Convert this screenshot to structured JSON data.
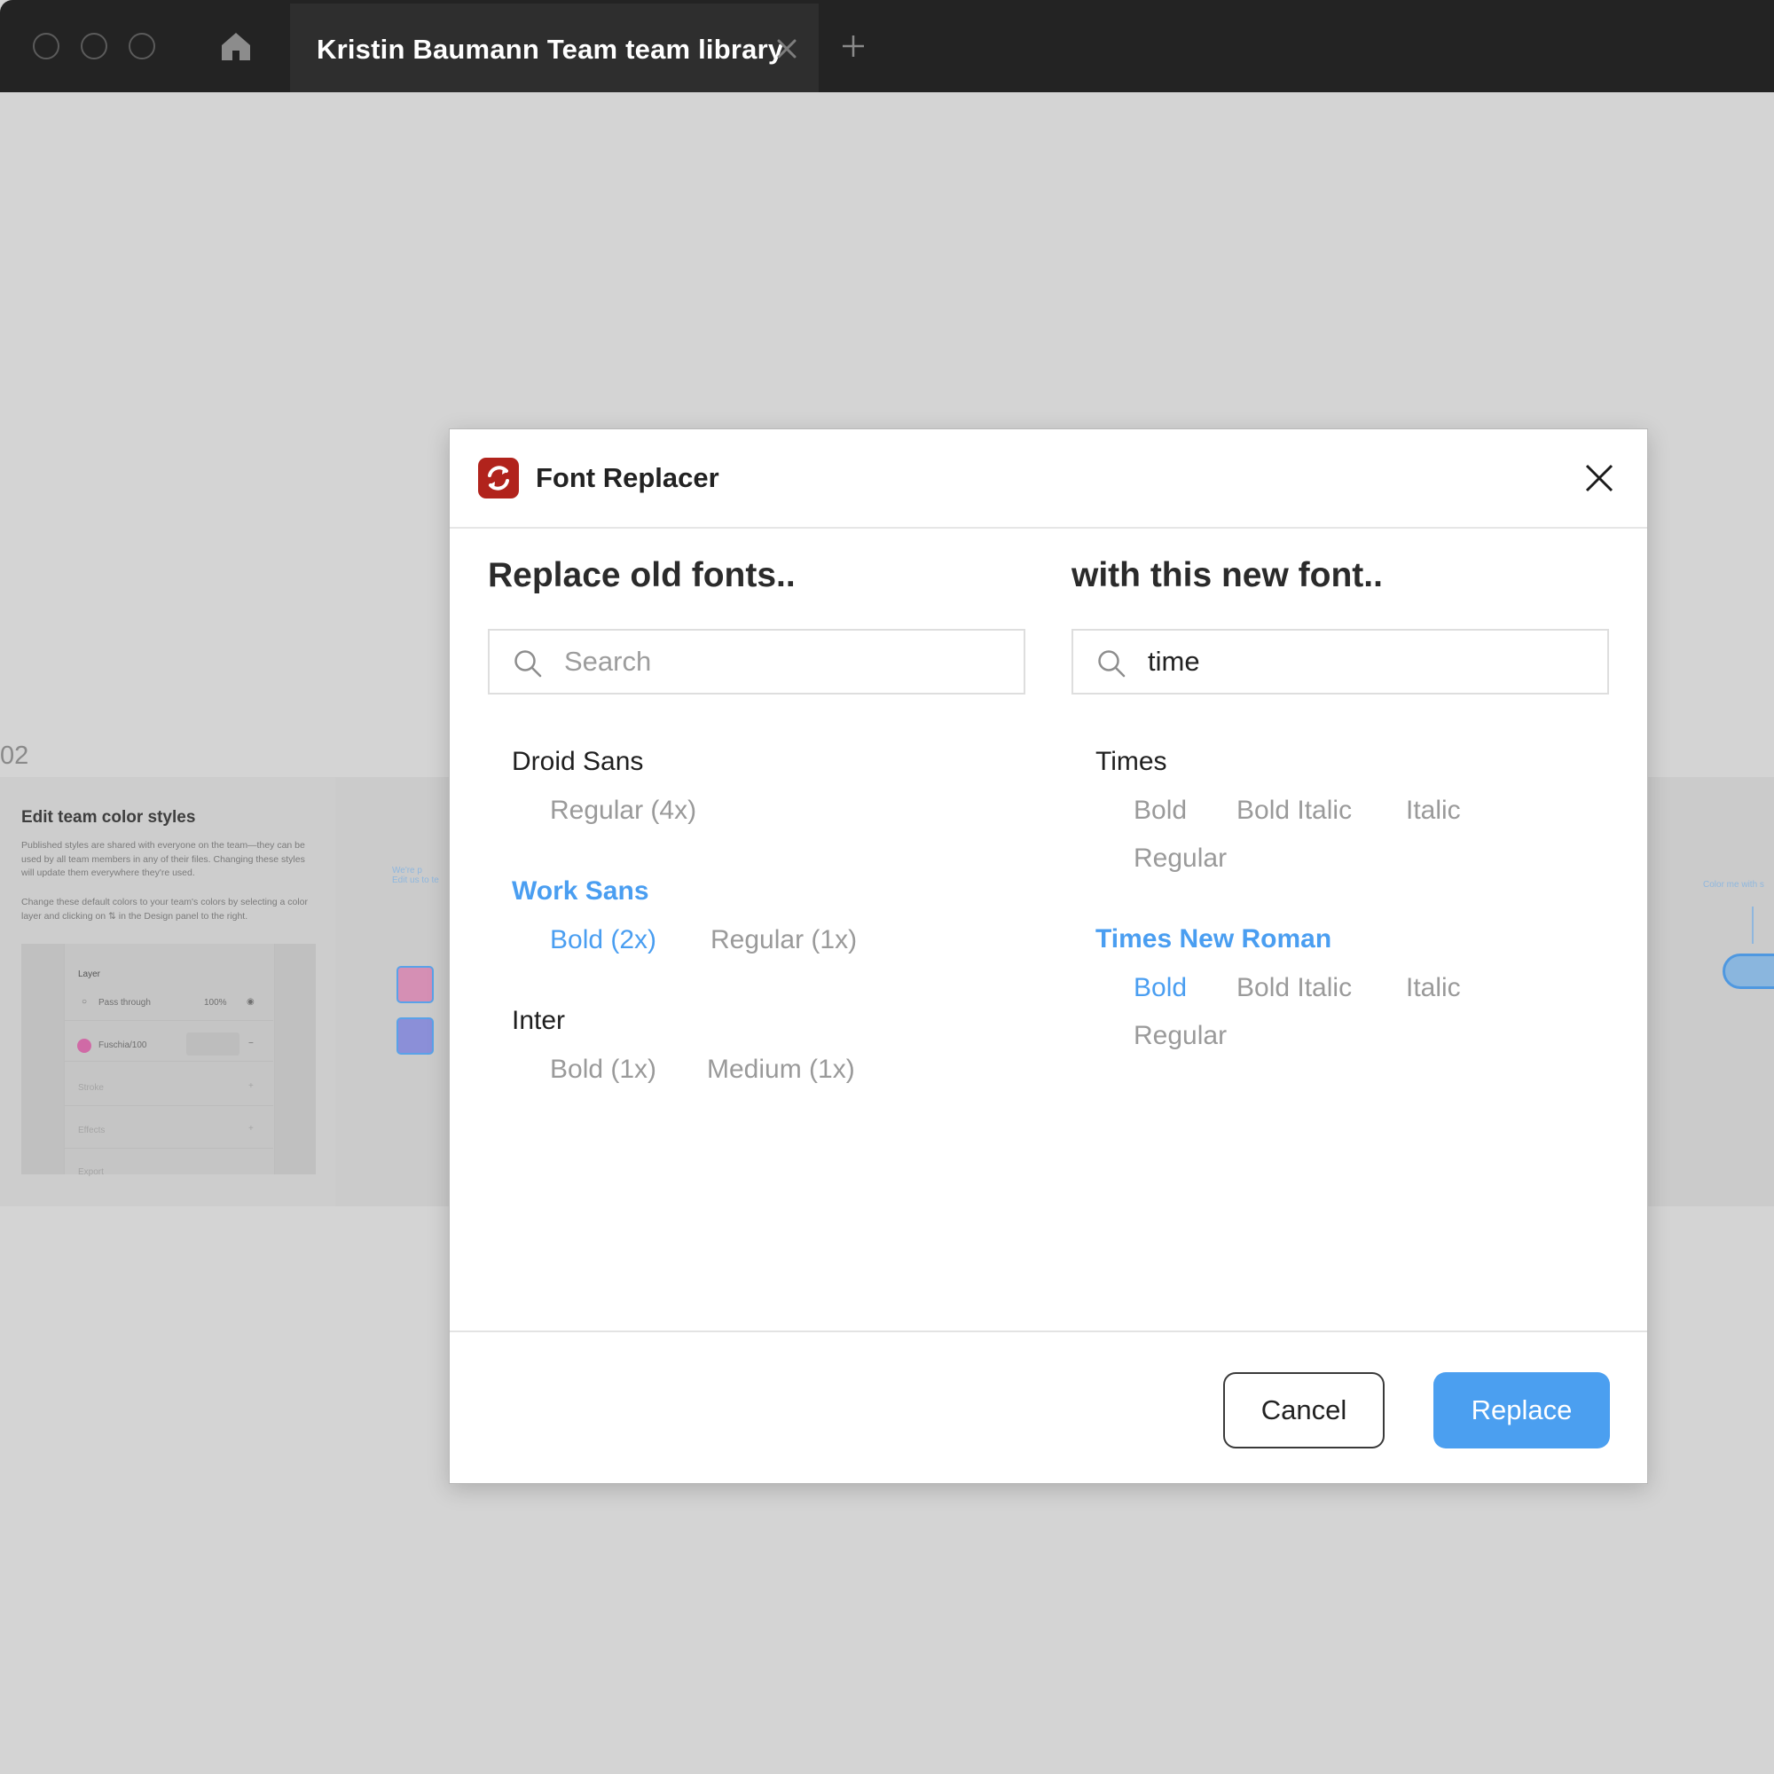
{
  "window": {
    "tab_title": "Kristin Baumann Team team library"
  },
  "canvas": {
    "frame_number": "02",
    "card_title": "Edit team color styles",
    "card_desc": "Published styles are shared with everyone on the team—they can be used by all team members in any of their files. Changing these styles will update them everywhere they're used.",
    "card_desc2": "Change these default colors to your team's colors by selecting a color layer and clicking on ⇅ in the Design panel to the right.",
    "panel": {
      "layer_label": "Layer",
      "blend_mode": "Pass through",
      "opacity": "100%",
      "fill_name": "Fuschia/100",
      "stroke_label": "Stroke",
      "effects_label": "Effects",
      "export_label": "Export"
    },
    "hint_left": "We're p\nEdit us to te",
    "hint_right": "Color me with s",
    "colors": {
      "swatch_pink": "#d58fb4",
      "swatch_purple": "#8b8fd8",
      "fill_dot": "#d06aa6"
    }
  },
  "dialog": {
    "app_title": "Font Replacer",
    "left": {
      "heading": "Replace old fonts..",
      "search_placeholder": "Search",
      "search_value": "",
      "families": [
        {
          "name": "Droid Sans",
          "styles": [
            "Regular (4x)"
          ]
        },
        {
          "name": "Work Sans",
          "styles": [
            "Bold (2x)",
            "Regular (1x)"
          ]
        },
        {
          "name": "Inter",
          "styles": [
            "Bold (1x)",
            "Medium (1x)"
          ]
        }
      ]
    },
    "right": {
      "heading": "with this new font..",
      "search_placeholder": "Search",
      "search_value": "time",
      "families": [
        {
          "name": "Times",
          "styles": [
            "Bold",
            "Bold Italic",
            "Italic",
            "Regular"
          ]
        },
        {
          "name": "Times New Roman",
          "styles": [
            "Bold",
            "Bold Italic",
            "Italic",
            "Regular"
          ]
        }
      ]
    },
    "buttons": {
      "cancel": "Cancel",
      "replace": "Replace"
    },
    "colors": {
      "accent": "#4a9ef1",
      "app_icon": "#b1231c"
    }
  }
}
